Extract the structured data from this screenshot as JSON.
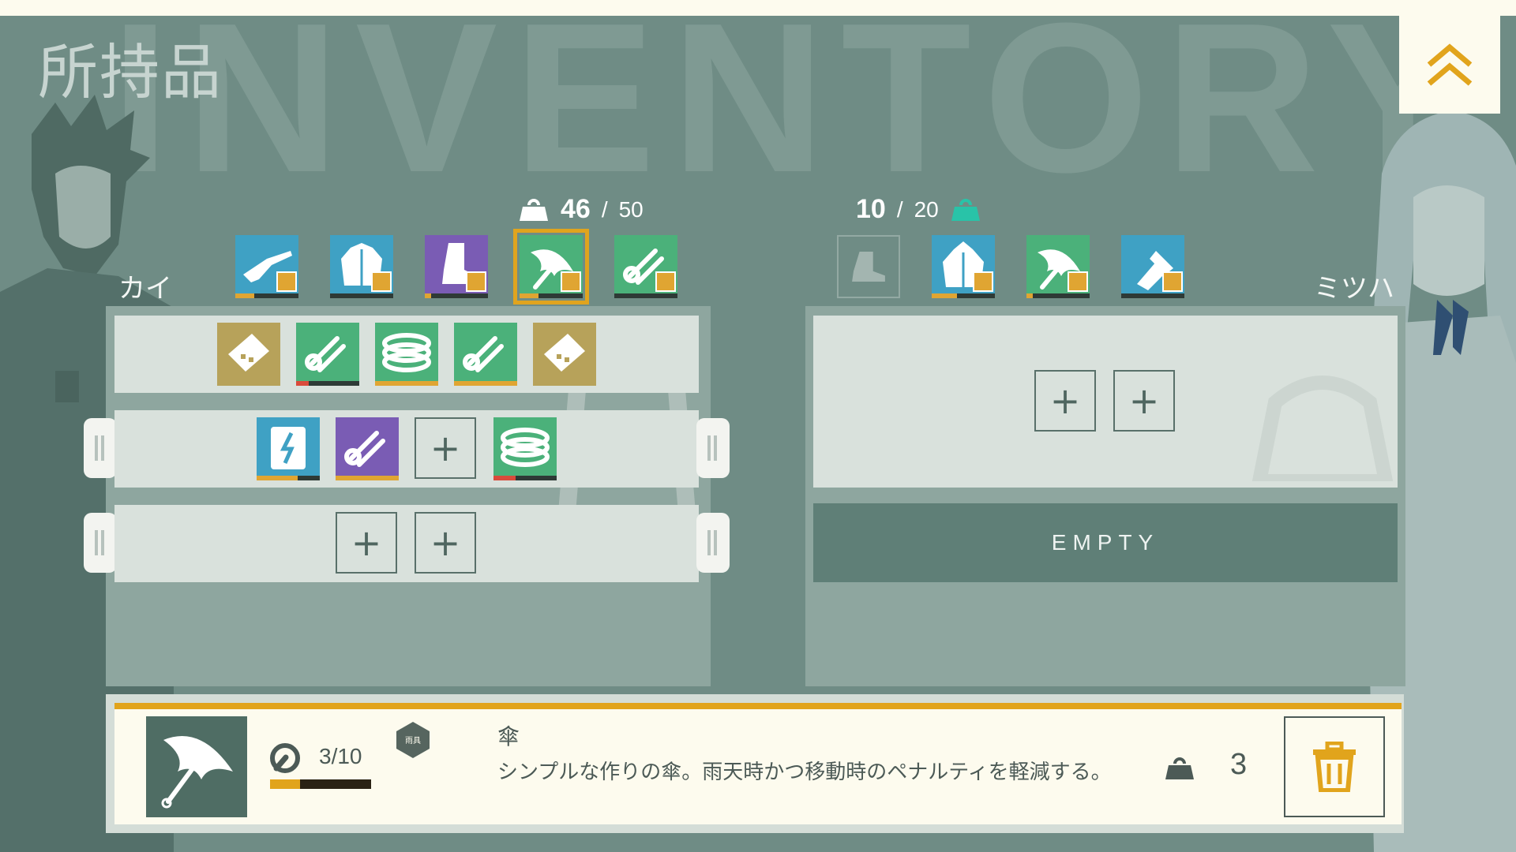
{
  "page": {
    "title": "所持品",
    "background_word": "INVENTORY"
  },
  "left_character": {
    "name": "カイ",
    "weight": {
      "current": "46",
      "separator": "/",
      "max": "50"
    },
    "equipment": [
      {
        "icon": "rifle-icon",
        "color": "#3fa1c4",
        "fill": 0.3,
        "badge": true
      },
      {
        "icon": "jacket-icon",
        "color": "#3fa1c4",
        "fill": 0.0,
        "badge": true
      },
      {
        "icon": "boots-icon",
        "color": "#7a5cb4",
        "fill": 0.1,
        "badge": true
      },
      {
        "icon": "umbrella-icon",
        "color": "#4bb17a",
        "fill": 0.3,
        "badge": true,
        "selected": true
      },
      {
        "icon": "rope-icon",
        "color": "#4bb17a",
        "fill": 0.0,
        "badge": true
      }
    ],
    "rows": [
      {
        "items": [
          {
            "icon": "ticket-icon",
            "color": "#b7a25a"
          },
          {
            "icon": "rope-icon",
            "color": "#4bb17a",
            "fill": 0.2,
            "fill_color": "#d94b3b"
          },
          {
            "icon": "coil-icon",
            "color": "#4bb17a",
            "fill": 1.0,
            "fill_color": "#e0a532"
          },
          {
            "icon": "rope-icon",
            "color": "#4bb17a",
            "fill": 1.0,
            "fill_color": "#e0a532"
          },
          {
            "icon": "ticket-icon",
            "color": "#b7a25a"
          }
        ]
      },
      {
        "items": [
          {
            "icon": "battery-book-icon",
            "color": "#3fa1c4",
            "fill": 0.65,
            "fill_color": "#e0a532"
          },
          {
            "icon": "rope-icon",
            "color": "#7a5cb4",
            "fill": 1.0,
            "fill_color": "#e0a532"
          },
          {
            "icon": "add-slot",
            "label": "+"
          },
          {
            "icon": "coil-icon",
            "color": "#4bb17a",
            "fill": 0.35,
            "fill_color": "#d94b3b"
          }
        ]
      },
      {
        "items": [
          {
            "icon": "add-slot",
            "label": "+"
          },
          {
            "icon": "add-slot",
            "label": "+"
          }
        ]
      }
    ]
  },
  "right_character": {
    "name": "ミツハ",
    "weight": {
      "current": "10",
      "separator": "/",
      "max": "20"
    },
    "equipment": [
      {
        "icon": "boots-icon",
        "color": "#7b938c",
        "empty": true
      },
      {
        "icon": "raincoat-icon",
        "color": "#3fa1c4",
        "fill": 0.4,
        "badge": true
      },
      {
        "icon": "umbrella-icon",
        "color": "#4bb17a",
        "fill": 0.1,
        "badge": true
      },
      {
        "icon": "flashlight-icon",
        "color": "#3fa1c4",
        "fill": 0.0,
        "badge": true
      }
    ],
    "rows": [
      {
        "items": [
          {
            "icon": "add-slot",
            "label": "+"
          },
          {
            "icon": "add-slot",
            "label": "+"
          }
        ]
      }
    ],
    "empty_label": "EMPTY"
  },
  "detail": {
    "icon": "umbrella-icon",
    "durability_text": "3/10",
    "durability": 0.3,
    "category": "雨具",
    "name": "傘",
    "description": "シンプルな作りの傘。雨天時かつ移動時のペナルティを軽減する。",
    "weight": "3"
  },
  "colors": {
    "accent": "#e1a41c",
    "panel": "#8ea69f",
    "row": "#d9e1dc",
    "cream": "#fdfbee",
    "teal_weight": "#29c3a8"
  }
}
